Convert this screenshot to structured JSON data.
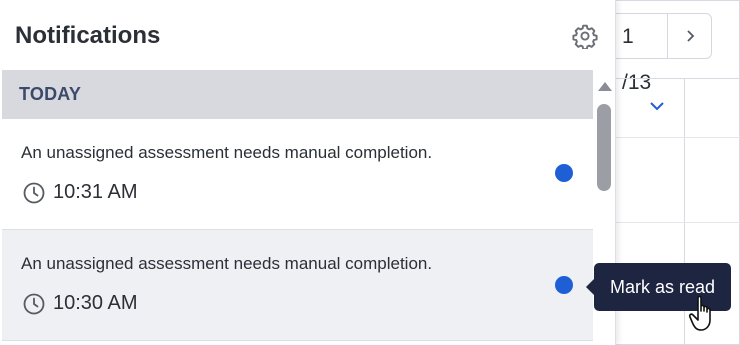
{
  "panel": {
    "title": "Notifications",
    "settings_icon": "gear-icon"
  },
  "background": {
    "pager_text": "1 /13",
    "next_icon": "chevron-right-icon",
    "dropdown_icon": "chevron-down-icon"
  },
  "sections": [
    {
      "label": "TODAY",
      "items": [
        {
          "message": "An unassigned assessment needs manual completion.",
          "time": "10:31 AM",
          "unread": true
        },
        {
          "message": "An unassigned assessment needs manual completion.",
          "time": "10:30 AM",
          "unread": true
        }
      ]
    }
  ],
  "tooltip": {
    "text": "Mark as read"
  },
  "colors": {
    "unread_dot": "#1f5fd6",
    "section_bg": "#d8d9df",
    "tooltip_bg": "#1d2540",
    "hover_row": "#eef0f4"
  }
}
